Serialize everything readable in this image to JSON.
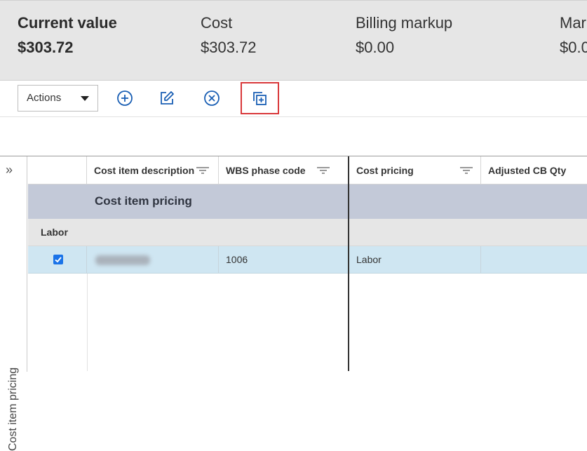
{
  "summary": {
    "current_value": {
      "label": "Current value",
      "value": "$303.72"
    },
    "cost": {
      "label": "Cost",
      "value": "$303.72"
    },
    "billing_markup": {
      "label": "Billing markup",
      "value": "$0.00"
    },
    "margin": {
      "label": "Mar",
      "value": "$0.0"
    }
  },
  "toolbar": {
    "actions_label": "Actions",
    "icons": [
      "add-circle-icon",
      "edit-icon",
      "cancel-circle-icon",
      "duplicate-icon"
    ],
    "accent_color": "#1a5fb4",
    "highlight_color": "#d9383a"
  },
  "side_rail": {
    "label": "Cost item pricing",
    "expand_icon": "double-chevron-right-icon"
  },
  "grid": {
    "columns": [
      "Cost item description",
      "WBS phase code",
      "Cost pricing",
      "Adjusted CB Qty"
    ],
    "group_label": "Cost item pricing",
    "subgroup_label": "Labor",
    "rows": [
      {
        "checked": true,
        "wbs_phase_code": "1006",
        "cost_pricing": "Labor"
      }
    ]
  }
}
